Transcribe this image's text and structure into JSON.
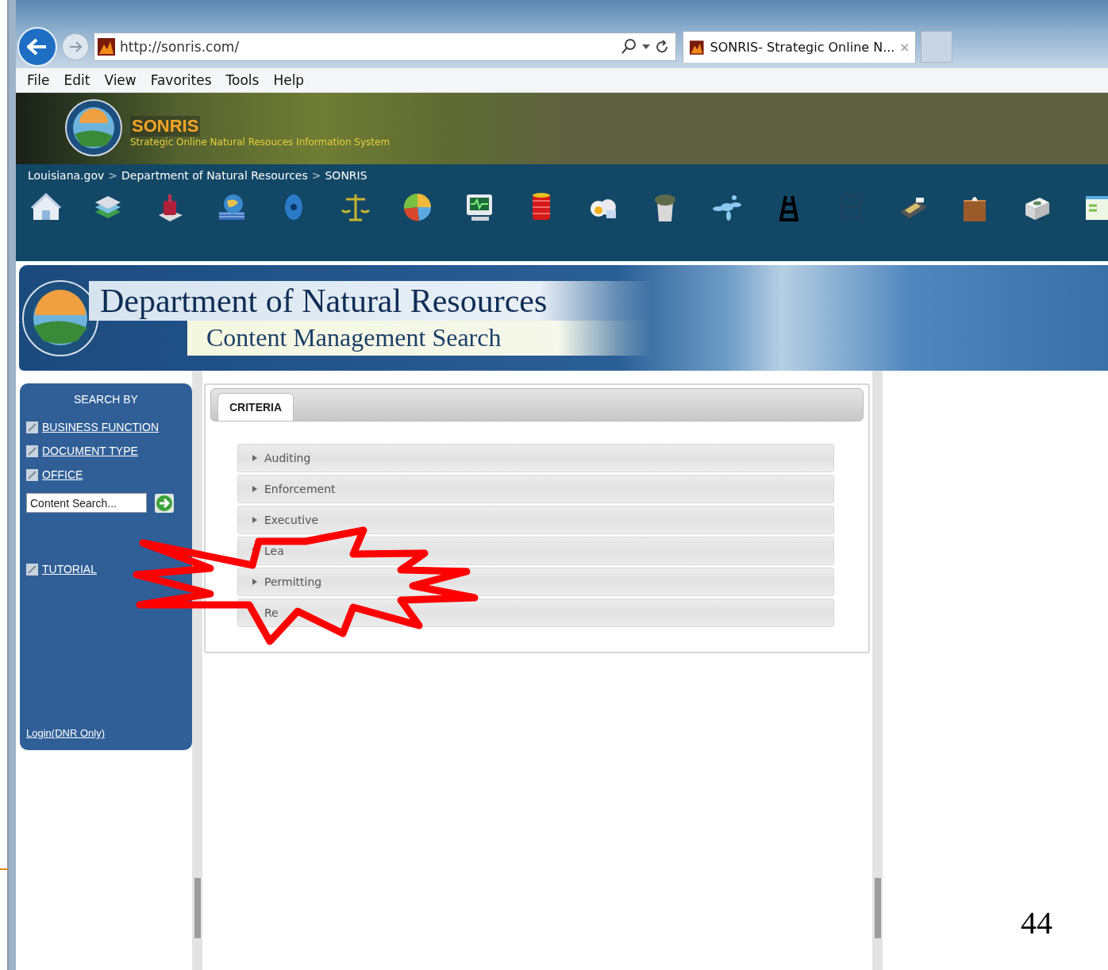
{
  "browser": {
    "url": "http://sonris.com/",
    "tab_title": "SONRIS- Strategic Online N..."
  },
  "menu": [
    "File",
    "Edit",
    "View",
    "Favorites",
    "Tools",
    "Help"
  ],
  "banner": {
    "title": "SONRIS",
    "subtitle": "Strategic Online Natural Resouces Information System"
  },
  "breadcrumb": {
    "items": [
      "Louisiana.gov",
      "Department of Natural Resources",
      "SONRIS"
    ],
    "separator": ">"
  },
  "header": {
    "title": "Department of Natural Resources",
    "subtitle": "Content Management Search"
  },
  "sidebar": {
    "heading": "SEARCH BY",
    "links": [
      "BUSINESS FUNCTION",
      "DOCUMENT TYPE",
      "OFFICE"
    ],
    "search": {
      "placeholder": "Content Search..."
    },
    "tutorial": "TUTORIAL",
    "login": "Login(DNR Only)"
  },
  "tabs": [
    {
      "label": "CRITERIA",
      "selected": true
    }
  ],
  "categories": [
    {
      "label": "Auditing",
      "expanded": false
    },
    {
      "label": "Enforcement",
      "expanded": false
    },
    {
      "label": "Executive",
      "expanded": false
    },
    {
      "label": "Lea",
      "expanded": false
    },
    {
      "label": "Permitting",
      "expanded": false
    },
    {
      "label": "Re",
      "expanded": false
    }
  ],
  "page_number": "44"
}
